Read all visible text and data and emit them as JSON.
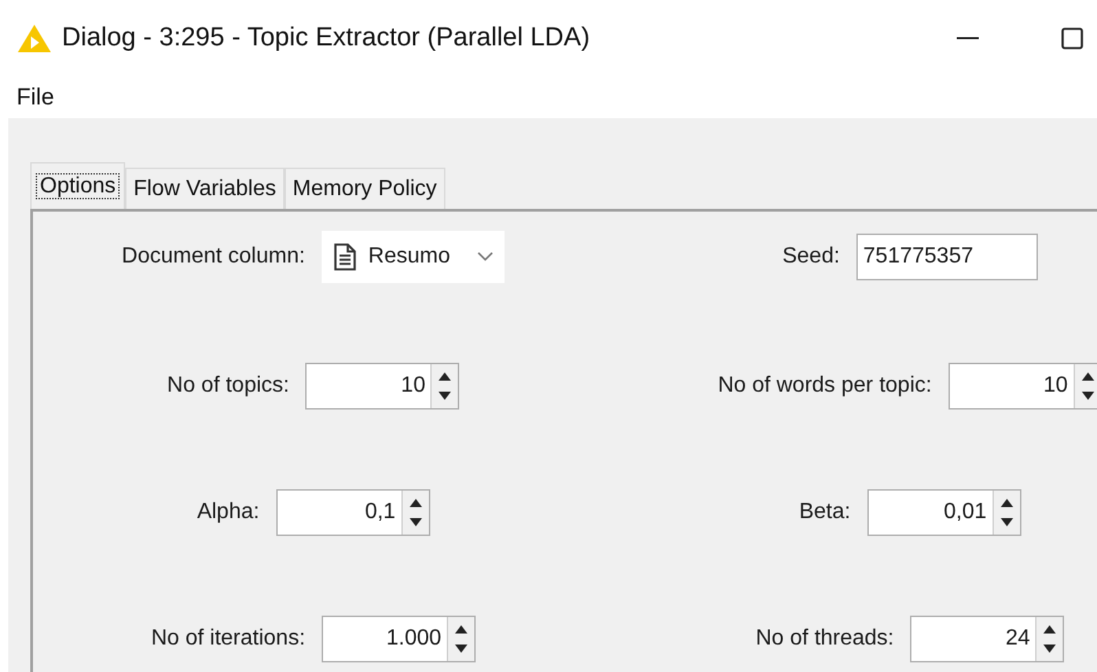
{
  "window": {
    "title": "Dialog - 3:295 - Topic Extractor (Parallel LDA)"
  },
  "menu": [
    "File"
  ],
  "tabs": [
    {
      "label": "Options",
      "selected": true
    },
    {
      "label": "Flow Variables",
      "selected": false
    },
    {
      "label": "Memory Policy",
      "selected": false
    }
  ],
  "rows": [
    [
      {
        "kind": "combo",
        "label": "Document column:",
        "value": "Resumo"
      },
      {
        "kind": "text",
        "label": "Seed:",
        "value": "751775357"
      }
    ],
    [
      {
        "kind": "spinner",
        "label": "No of topics:",
        "value": "10"
      },
      {
        "kind": "spinner",
        "label": "No of words per topic:",
        "value": "10"
      }
    ],
    [
      {
        "kind": "spinner",
        "label": "Alpha:",
        "value": "0,1"
      },
      {
        "kind": "spinner",
        "label": "Beta:",
        "value": "0,01"
      }
    ],
    [
      {
        "kind": "spinner",
        "label": "No of iterations:",
        "value": "1.000"
      },
      {
        "kind": "spinner",
        "label": "No of threads:",
        "value": "24"
      }
    ]
  ]
}
